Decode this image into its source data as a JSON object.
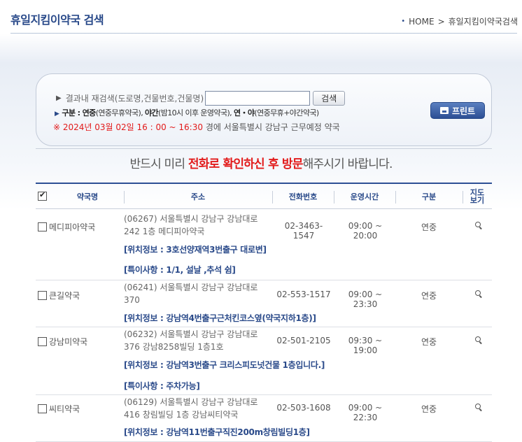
{
  "header": {
    "title": "휴일지킴이약국 검색",
    "breadcrumb": [
      "HOME",
      "휴일지킴이약국검색"
    ],
    "breadcrumb_sep": ">"
  },
  "search": {
    "label": "결과내 재검색(도로명,건물번호,건물명)",
    "input_value": "",
    "button": "검색",
    "legend_prefix": "구분 : ",
    "legend_1_b": "연중",
    "legend_1": "(연중무휴약국), ",
    "legend_2_b": "야간",
    "legend_2": "(밤10시 이후 운영약국), ",
    "legend_3_b": "연・야",
    "legend_3": "(연중무휴+야간약국)",
    "datetime": "※ 2024년 03월 02일 16 : 00 ~ 16:30",
    "datetime_suffix": " 경에  서울특별시  강남구   근무예정 약국",
    "print": "프린트"
  },
  "notice": {
    "pre": "반드시 미리 ",
    "red": "전화로 확인하신 후 방문",
    "post": "해주시기 바랍니다."
  },
  "table": {
    "headers": {
      "name": "약국명",
      "address": "주소",
      "tel": "전화번호",
      "hours": "운영시간",
      "type": "구분",
      "map": "지도\n보기"
    },
    "rows": [
      {
        "name": "메디피아약국",
        "address": "(06267) 서울특별시 강남구 강남대로 242 1층 메디피아약국",
        "tel": "02-3463-1547",
        "hours": "09:00 ~ 20:00",
        "type": "연중",
        "location": "[위치정보 : 3호선양재역3번출구 대로변]",
        "note": "[특이사항 : 1/1, 설날 ,추석 쉼]"
      },
      {
        "name": "큰길약국",
        "address": "(06241) 서울특별시 강남구 강남대로 370",
        "tel": "02-553-1517",
        "hours": "09:00 ~ 23:30",
        "type": "연중",
        "location": "[위치정보 : 강남역4번출구근처킨코스옆(약국지하1층)]",
        "note": ""
      },
      {
        "name": "강남미약국",
        "address": "(06232) 서울특별시 강남구 강남대로 376 강남8258빌딩 1층1호",
        "tel": "02-501-2105",
        "hours": "09:30 ~ 19:00",
        "type": "연중",
        "location": "[위치정보 : 강남역3번출구 크리스피도넛건물 1층입니다.]",
        "note": "[특이사항 : 주차가능]"
      },
      {
        "name": "씨티약국",
        "address": "(06129) 서울특별시 강남구 강남대로 416 창림빌딩 1층 강남씨티약국",
        "tel": "02-503-1608",
        "hours": "09:00 ~ 22:30",
        "type": "연중",
        "location": "[위치정보 : 강남역11번출구직진200m창림빌딩1층]",
        "note": ""
      }
    ]
  }
}
